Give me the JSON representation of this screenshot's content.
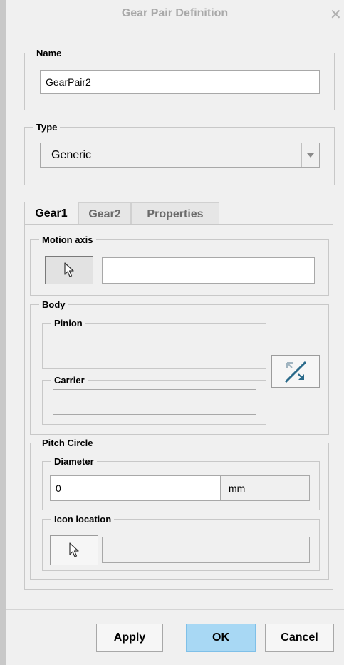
{
  "window": {
    "title": "Gear Pair Definition",
    "close_glyph": "✕"
  },
  "name_group": {
    "legend": "Name",
    "value": "GearPair2"
  },
  "type_group": {
    "legend": "Type",
    "selected": "Generic"
  },
  "tabs": [
    {
      "label": "Gear1",
      "active": true
    },
    {
      "label": "Gear2",
      "active": false
    },
    {
      "label": "Properties",
      "active": false
    }
  ],
  "gear1": {
    "motion_axis": {
      "legend": "Motion axis",
      "value": ""
    },
    "body": {
      "legend": "Body",
      "pinion": {
        "legend": "Pinion",
        "value": ""
      },
      "carrier": {
        "legend": "Carrier",
        "value": ""
      }
    },
    "pitch_circle": {
      "legend": "Pitch Circle",
      "diameter": {
        "legend": "Diameter",
        "value": "0",
        "unit": "mm"
      },
      "icon_location": {
        "legend": "Icon location",
        "value": ""
      }
    }
  },
  "buttons": {
    "apply": "Apply",
    "ok": "OK",
    "cancel": "Cancel"
  },
  "colors": {
    "ok_button": "#a8d8f4",
    "swap_icon": "#2a6a8a",
    "background": "#f0f0f0"
  }
}
